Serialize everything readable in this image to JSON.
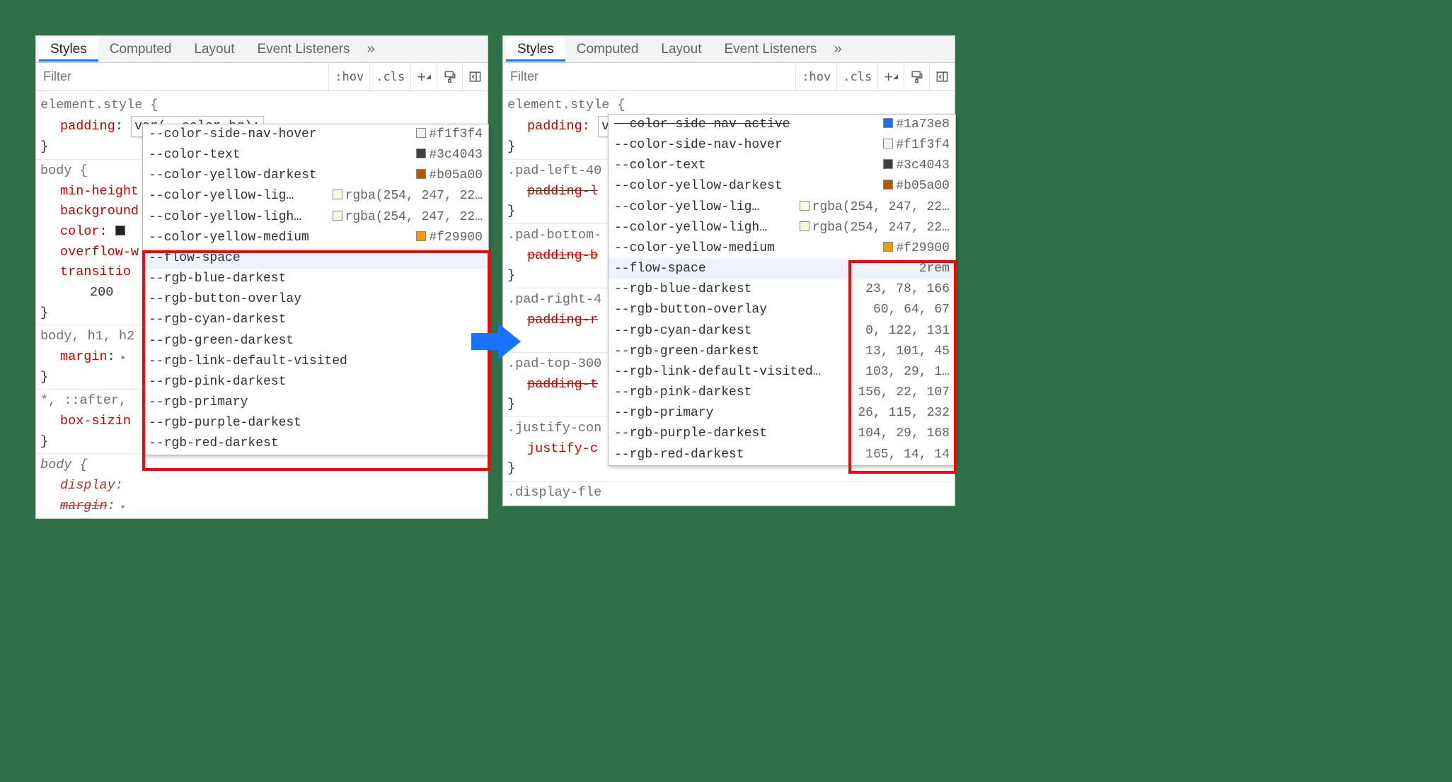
{
  "tabs": [
    "Styles",
    "Computed",
    "Layout",
    "Event Listeners"
  ],
  "active_tab": 0,
  "filter_placeholder": "Filter",
  "toolbar": {
    "hov": ":hov",
    "cls": ".cls"
  },
  "element_style": {
    "selector": "element.style {",
    "prop": "padding",
    "value_editing": "var(--color-bg);",
    "close": "}"
  },
  "left": {
    "rules": [
      {
        "selector": "body {",
        "props": [
          {
            "name": "min-height"
          },
          {
            "name": "background"
          },
          {
            "name": "color",
            "swatch": "#222"
          },
          {
            "name": "overflow-w"
          },
          {
            "name": "transitio"
          }
        ],
        "extra_indent": "200",
        "close": "}"
      },
      {
        "selector_html": "body, h1, h2",
        "props": [
          {
            "name": "margin",
            "has_tri": true
          }
        ],
        "close": "}"
      },
      {
        "selector_html": "*, ::after,",
        "props": [
          {
            "name": "box-sizin"
          }
        ],
        "close": "}"
      },
      {
        "selector_italic": "body {",
        "props_italic": [
          {
            "name": "display",
            "colon": true
          },
          {
            "name": "margin",
            "struck": true,
            "has_tri": true
          }
        ]
      }
    ],
    "ac_top": [
      {
        "name": "--color-side-nav-hover",
        "swatch": "#f1f3f4",
        "val": "#f1f3f4"
      },
      {
        "name": "--color-text",
        "swatch": "#3c4043",
        "val": "#3c4043"
      },
      {
        "name": "--color-yellow-darkest",
        "swatch": "#b05a00",
        "val": "#b05a00"
      },
      {
        "name": "--color-yellow-lig…",
        "swatch": "#fef7e0",
        "val": "rgba(254, 247, 22…"
      },
      {
        "name": "--color-yellow-ligh…",
        "swatch": "#fef7e0",
        "val": "rgba(254, 247, 22…"
      },
      {
        "name": "--color-yellow-medium",
        "swatch": "#f29900",
        "val": "#f29900"
      }
    ],
    "ac_bottom": [
      {
        "name": "--flow-space",
        "hl": true
      },
      {
        "name": "--rgb-blue-darkest"
      },
      {
        "name": "--rgb-button-overlay"
      },
      {
        "name": "--rgb-cyan-darkest"
      },
      {
        "name": "--rgb-green-darkest"
      },
      {
        "name": "--rgb-link-default-visited"
      },
      {
        "name": "--rgb-pink-darkest"
      },
      {
        "name": "--rgb-primary"
      },
      {
        "name": "--rgb-purple-darkest"
      },
      {
        "name": "--rgb-red-darkest"
      }
    ]
  },
  "right": {
    "rules": [
      {
        "selector": ".pad-left-40",
        "props": [
          {
            "name": "padding-l",
            "struck": true
          }
        ],
        "close": "}"
      },
      {
        "selector": ".pad-bottom-",
        "props": [
          {
            "name": "padding-b",
            "struck": true
          }
        ],
        "close": "}"
      },
      {
        "selector": ".pad-right-4",
        "props": [
          {
            "name": "padding-r",
            "struck": true
          }
        ],
        "close": "}"
      },
      {
        "selector": ".pad-top-300",
        "props": [
          {
            "name": "padding-t",
            "struck": true
          }
        ],
        "close": "}"
      },
      {
        "selector": ".justify-con",
        "props": [
          {
            "name": "justify-c"
          }
        ],
        "close": "}"
      },
      {
        "selector": ".display-fle"
      }
    ],
    "ac_top_extra": {
      "name_cut": "color side nav active",
      "swatch": "#1a73e8",
      "val": "#1a73e8"
    },
    "ac_top": [
      {
        "name": "--color-side-nav-hover",
        "swatch": "#f1f3f4",
        "val": "#f1f3f4"
      },
      {
        "name": "--color-text",
        "swatch": "#3c4043",
        "val": "#3c4043"
      },
      {
        "name": "--color-yellow-darkest",
        "swatch": "#b05a00",
        "val": "#b05a00"
      },
      {
        "name": "--color-yellow-lig…",
        "swatch": "#fef7e0",
        "val": "rgba(254, 247, 22…"
      },
      {
        "name": "--color-yellow-ligh…",
        "swatch": "#fef7e0",
        "val": "rgba(254, 247, 22…"
      },
      {
        "name": "--color-yellow-medium",
        "swatch": "#f29900",
        "val": "#f29900"
      }
    ],
    "ac_bottom": [
      {
        "name": "--flow-space",
        "val": "2rem",
        "hl": true
      },
      {
        "name": "--rgb-blue-darkest",
        "val": "23, 78, 166"
      },
      {
        "name": "--rgb-button-overlay",
        "val": "60, 64, 67"
      },
      {
        "name": "--rgb-cyan-darkest",
        "val": "0, 122, 131"
      },
      {
        "name": "--rgb-green-darkest",
        "val": "13, 101, 45"
      },
      {
        "name": "--rgb-link-default-visited…",
        "val": "103, 29, 1…"
      },
      {
        "name": "--rgb-pink-darkest",
        "val": "156, 22, 107"
      },
      {
        "name": "--rgb-primary",
        "val": "26, 115, 232"
      },
      {
        "name": "--rgb-purple-darkest",
        "val": "104, 29, 168"
      },
      {
        "name": "--rgb-red-darkest",
        "val": "165, 14, 14"
      }
    ]
  }
}
